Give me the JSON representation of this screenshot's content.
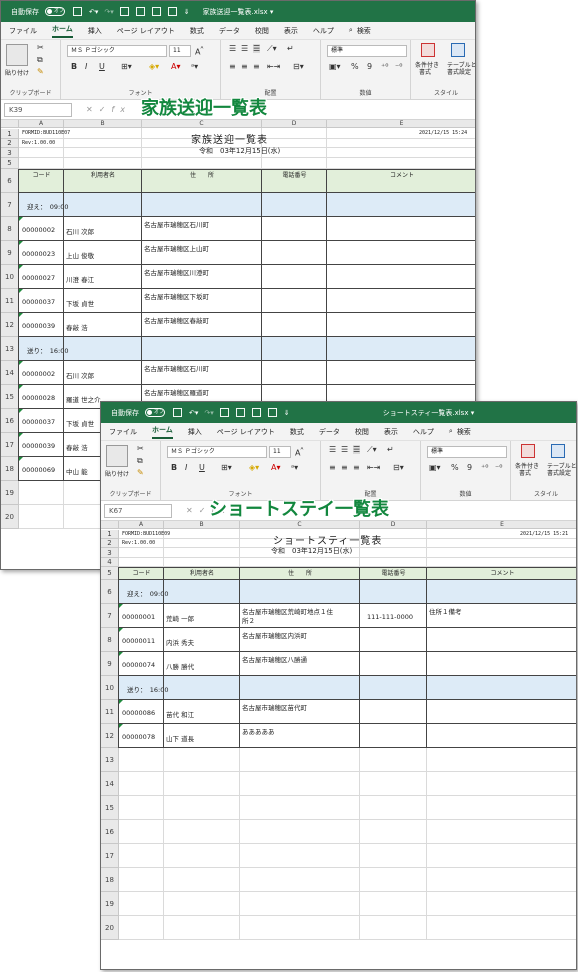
{
  "windows": [
    {
      "autosave_label": "自動保存",
      "autosave_state": "オフ",
      "filename": "家族送迎一覧表.xlsx",
      "overlay_title": "家族送迎一覧表",
      "tabs": [
        "ファイル",
        "ホーム",
        "挿入",
        "ページ レイアウト",
        "数式",
        "データ",
        "校閲",
        "表示",
        "ヘルプ",
        "検索"
      ],
      "ribbon": {
        "paste": "貼り付け",
        "font_name": "ＭＳ Ｐゴシック",
        "font_size": "11",
        "number_format": "標準",
        "clipboard": "クリップボード",
        "font": "フォント",
        "alignment": "配置",
        "number": "数値",
        "style": "スタイル",
        "cond_format": "条件付き",
        "cond_format2": "書式",
        "table_format": "テーブルとし",
        "table_format2": "書式設定"
      },
      "namebox": "K39",
      "columns": [
        "A",
        "B",
        "C",
        "D",
        "E"
      ],
      "sheet": {
        "formid": "FORMID:BUD110E07",
        "rev": "Rev:1.00.00",
        "date": "2021/12/15 15:24",
        "title": "家族送迎一覧表",
        "subtitle": "令和　03年12月15日(水)",
        "headers": [
          "コード",
          "利用者名",
          "住　　所",
          "電話番号",
          "コメント"
        ],
        "sections": [
          {
            "label": "迎え：　09:00",
            "rows": [
              {
                "code": "00000002",
                "name": "石川 次郎",
                "addr": "名古屋市瑞穂区石川町"
              },
              {
                "code": "00000023",
                "name": "上山 俊敬",
                "addr": "名古屋市瑞穂区上山町"
              },
              {
                "code": "00000027",
                "name": "川澄 春江",
                "addr": "名古屋市瑞穂区川澄町"
              },
              {
                "code": "00000037",
                "name": "下坂 貞世",
                "addr": "名古屋市瑞穂区下坂町"
              },
              {
                "code": "00000039",
                "name": "春敲 浩",
                "addr": "名古屋市瑞穂区春敲町"
              }
            ]
          },
          {
            "label": "送り：　16:00",
            "rows": [
              {
                "code": "00000002",
                "name": "石川 次郎",
                "addr": "名古屋市瑞穂区石川町"
              },
              {
                "code": "00000028",
                "name": "羅道 世之介",
                "addr": "名古屋市瑞穂区羅道町"
              },
              {
                "code": "00000037",
                "name": "下坂 貞世",
                "addr": ""
              },
              {
                "code": "00000039",
                "name": "春敲 浩",
                "addr": ""
              },
              {
                "code": "00000069",
                "name": "中山 能",
                "addr": ""
              }
            ]
          }
        ]
      },
      "row_numbers": [
        "1",
        "2",
        "3",
        "5",
        "6",
        "7",
        "8",
        "9",
        "10",
        "11",
        "12",
        "13",
        "14",
        "15",
        "16",
        "17",
        "18",
        "19",
        "20"
      ]
    },
    {
      "autosave_label": "自動保存",
      "autosave_state": "オフ",
      "filename": "ショートスティ一覧表.xlsx",
      "overlay_title": "ショートステイ一覧表",
      "tabs": [
        "ファイル",
        "ホーム",
        "挿入",
        "ページ レイアウト",
        "数式",
        "データ",
        "校閲",
        "表示",
        "ヘルプ",
        "検索"
      ],
      "ribbon": {
        "paste": "貼り付け",
        "font_name": "ＭＳ Ｐゴシック",
        "font_size": "11",
        "number_format": "標準",
        "clipboard": "クリップボード",
        "font": "フォント",
        "alignment": "配置",
        "number": "数値",
        "style": "スタイル",
        "cond_format": "条件付き",
        "cond_format2": "書式",
        "table_format": "テーブルとし",
        "table_format2": "書式設定"
      },
      "namebox": "K67",
      "columns": [
        "A",
        "B",
        "C",
        "D",
        "E"
      ],
      "sheet": {
        "formid": "FORMID:BUD110E09",
        "rev": "Rev:1.00.00",
        "date": "2021/12/15 15:21",
        "title": "ショートスティ一覧表",
        "subtitle": "令和　03年12月15日(水)",
        "headers": [
          "コード",
          "利用者名",
          "住　　所",
          "電話番号",
          "コメント"
        ],
        "sections": [
          {
            "label": "迎え：　09:00",
            "rows": [
              {
                "code": "00000001",
                "name": "荒崎 一郎",
                "addr": "名古屋市瑞穂区荒崎町地点１住",
                "addr2": "所２",
                "tel": "111-111-0000",
                "comment": "住所１備考"
              },
              {
                "code": "00000011",
                "name": "内浜 秀夫",
                "addr": "名古屋市瑞穂区内浜町"
              },
              {
                "code": "00000074",
                "name": "八勝 勝代",
                "addr": "名古屋市瑞穂区八勝通"
              }
            ]
          },
          {
            "label": "送り：　16:00",
            "rows": [
              {
                "code": "00000086",
                "name": "苗代 和江",
                "addr": "名古屋市瑞穂区苗代町"
              },
              {
                "code": "00000078",
                "name": "山下 道長",
                "addr": "あああああ"
              }
            ]
          }
        ]
      },
      "row_numbers": [
        "1",
        "2",
        "3",
        "4",
        "5",
        "6",
        "7",
        "8",
        "9",
        "10",
        "11",
        "12",
        "13",
        "14",
        "15",
        "16",
        "17",
        "18",
        "19",
        "20"
      ]
    }
  ]
}
